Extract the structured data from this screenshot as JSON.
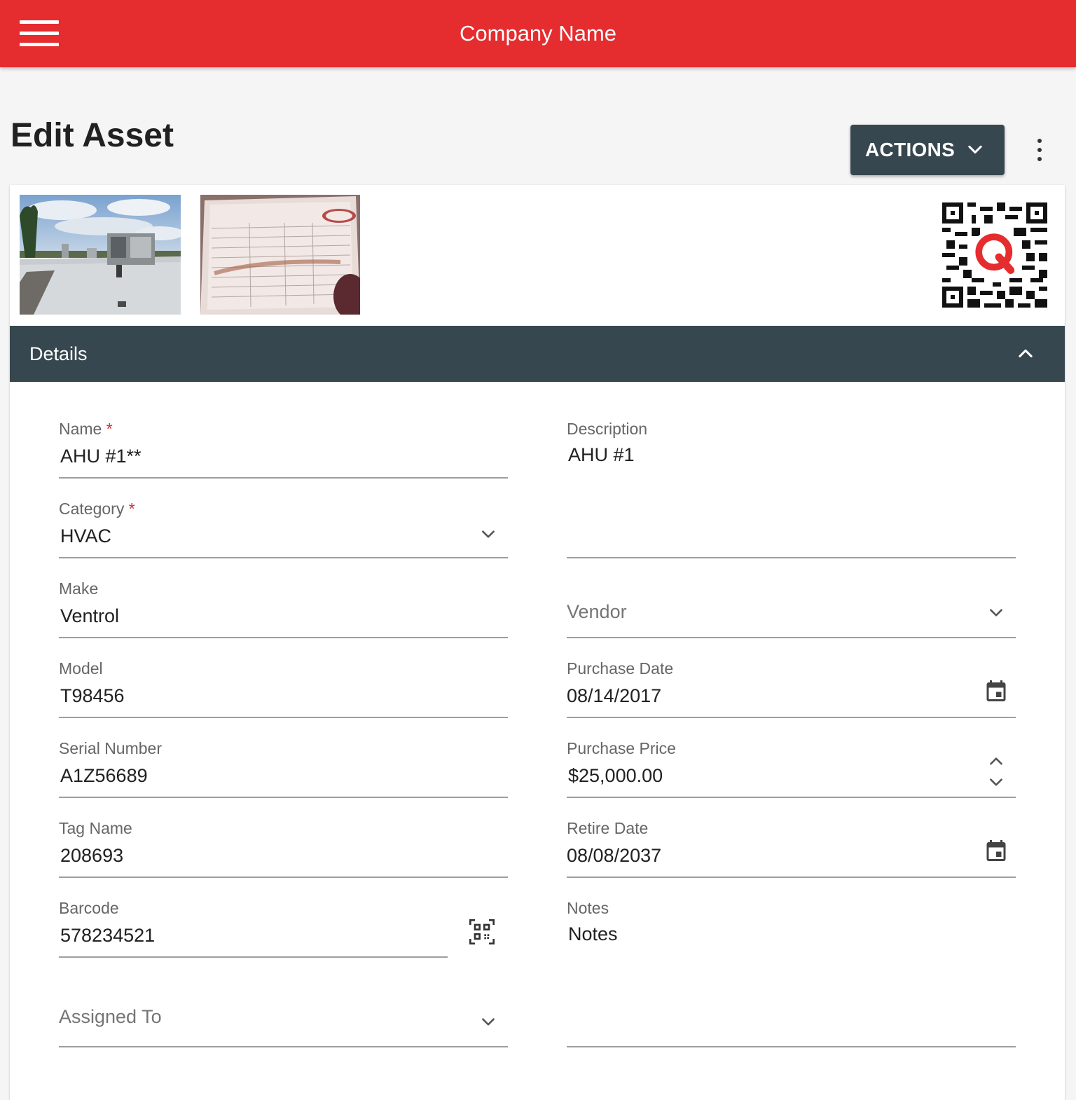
{
  "app": {
    "company_name": "Company Name",
    "brand_color": "#e52c2f",
    "header_color": "#37474f"
  },
  "page": {
    "title": "Edit Asset",
    "actions_label": "ACTIONS"
  },
  "details": {
    "title": "Details",
    "name": {
      "label": "Name",
      "required_mark": "*",
      "value": "AHU #1**"
    },
    "description": {
      "label": "Description",
      "value": "AHU #1"
    },
    "category": {
      "label": "Category",
      "required_mark": "*",
      "value": "HVAC"
    },
    "make": {
      "label": "Make",
      "value": "Ventrol"
    },
    "vendor": {
      "placeholder": "Vendor"
    },
    "model": {
      "label": "Model",
      "value": "T98456"
    },
    "purchase_date": {
      "label": "Purchase Date",
      "value": "08/14/2017"
    },
    "serial_number": {
      "label": "Serial Number",
      "value": "A1Z56689"
    },
    "purchase_price": {
      "label": "Purchase Price",
      "value": "$25,000.00"
    },
    "tag_name": {
      "label": "Tag Name",
      "value": "208693"
    },
    "retire_date": {
      "label": "Retire Date",
      "value": "08/08/2037"
    },
    "barcode": {
      "label": "Barcode",
      "value": "578234521"
    },
    "notes": {
      "label": "Notes",
      "value": "Notes"
    },
    "assigned_to": {
      "placeholder": "Assigned To"
    }
  },
  "icons": {
    "menu": "hamburger-icon",
    "actions_dropdown": "chevron-down-icon",
    "more": "kebab-icon",
    "collapse": "chevron-up-icon",
    "dropdown": "chevron-down-icon",
    "calendar": "calendar-icon",
    "stepper_up": "chevron-up-icon",
    "stepper_down": "chevron-down-icon",
    "scan": "qr-scan-icon",
    "qr": "qr-code-icon"
  }
}
